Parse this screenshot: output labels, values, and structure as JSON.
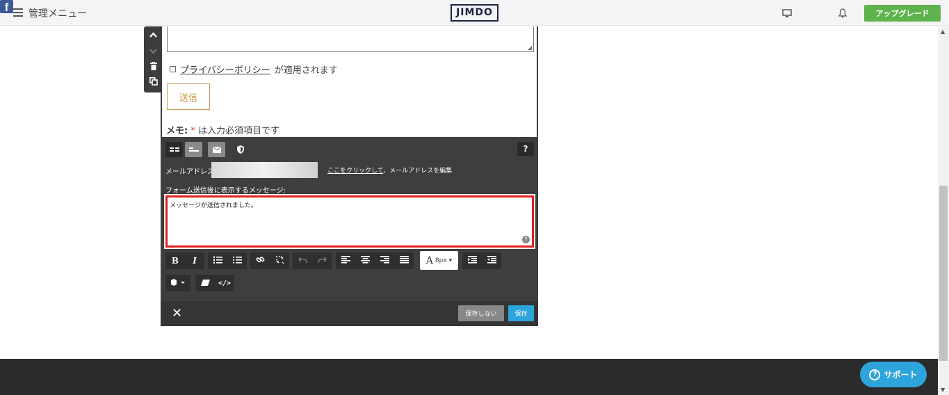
{
  "header": {
    "menu_label": "管理メニュー",
    "logo_text": "JIMDO",
    "upgrade_label": "アップグレード",
    "facebook_glyph": "f"
  },
  "form": {
    "privacy_link": "プライバシーポリシー",
    "privacy_suffix": "が適用されます",
    "send_label": "送信",
    "memo_prefix": "メモ:",
    "memo_star": "*",
    "memo_suffix": "は入力必須項目です"
  },
  "panel": {
    "help_label": "?",
    "email_label": "メールアドレス",
    "email_edit_link": "ここをクリックして",
    "email_edit_suffix": "、メールアドレスを編集",
    "message_label": "フォーム送信後に表示するメッセージ:",
    "message_text": "メッセージが送信されました。",
    "font_size": "8px",
    "no_save_label": "保存しない",
    "save_label": "保存"
  },
  "support": {
    "label": "サポート"
  },
  "colors": {
    "accent_green": "#5fb34c",
    "accent_blue": "#2ea4dc",
    "highlight_red": "#e01f1f"
  }
}
